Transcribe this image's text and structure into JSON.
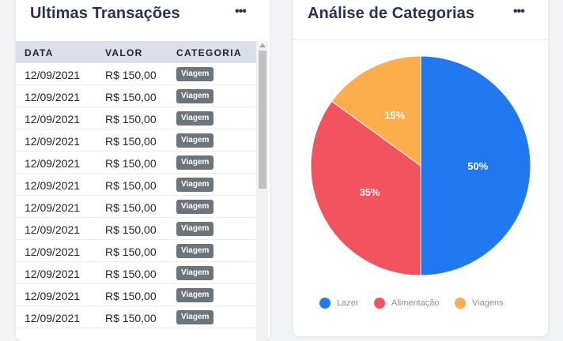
{
  "transactions": {
    "title": "Ultimas Transações",
    "more_label": "•••",
    "columns": [
      "DATA",
      "VALOR",
      "CATEGORIA"
    ],
    "rows": [
      {
        "date": "12/09/2021",
        "value": "R$ 150,00",
        "category": "Viagem"
      },
      {
        "date": "12/09/2021",
        "value": "R$ 150,00",
        "category": "Viagem"
      },
      {
        "date": "12/09/2021",
        "value": "R$ 150,00",
        "category": "Viagem"
      },
      {
        "date": "12/09/2021",
        "value": "R$ 150,00",
        "category": "Viagem"
      },
      {
        "date": "12/09/2021",
        "value": "R$ 150,00",
        "category": "Viagem"
      },
      {
        "date": "12/09/2021",
        "value": "R$ 150,00",
        "category": "Viagem"
      },
      {
        "date": "12/09/2021",
        "value": "R$ 150,00",
        "category": "Viagem"
      },
      {
        "date": "12/09/2021",
        "value": "R$ 150,00",
        "category": "Viagem"
      },
      {
        "date": "12/09/2021",
        "value": "R$ 150,00",
        "category": "Viagem"
      },
      {
        "date": "12/09/2021",
        "value": "R$ 150,00",
        "category": "Viagem"
      },
      {
        "date": "12/09/2021",
        "value": "R$ 150,00",
        "category": "Viagem"
      },
      {
        "date": "12/09/2021",
        "value": "R$ 150,00",
        "category": "Viagem"
      }
    ]
  },
  "categories": {
    "title": "Análise de Categorias",
    "more_label": "•••"
  },
  "colors": {
    "lazer": "#2079f0",
    "alimentacao": "#f2545f",
    "viagens": "#fbae4b",
    "badge": "#6c747c"
  },
  "chart_data": {
    "type": "pie",
    "title": "",
    "labels": [
      "Lazer",
      "Alimentação",
      "Viagens"
    ],
    "values": [
      50,
      35,
      15
    ],
    "value_labels": [
      "50%",
      "35%",
      "15%"
    ],
    "colors": [
      "#2079f0",
      "#f2545f",
      "#fbae4b"
    ],
    "legend": "bottom"
  }
}
